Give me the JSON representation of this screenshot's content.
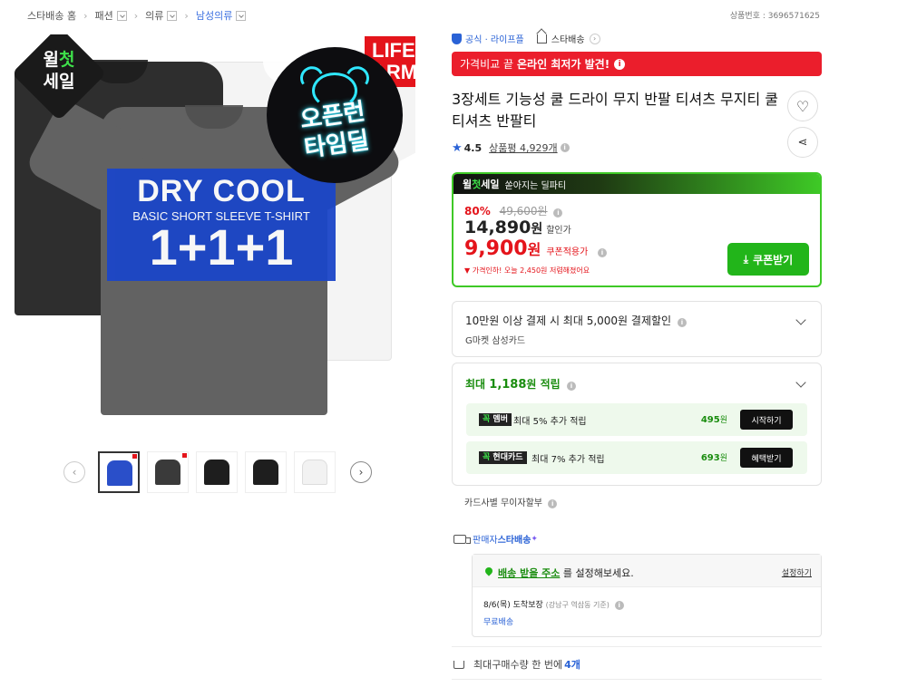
{
  "breadcrumb": {
    "home": "스타배송 홈",
    "level1": "패션",
    "level2": "의류",
    "level3": "남성의류"
  },
  "product_no": "상품번호 : 3696571625",
  "hero": {
    "badge_week_top": "윌",
    "badge_week_accent": "첫",
    "badge_week_bottom": "세일",
    "life_badge": "LIFE ARM",
    "clock_line1": "오픈런",
    "clock_line2": "타임딜",
    "drycool_title": "DRY COOL",
    "drycool_sub": "BASIC SHORT SLEEVE T-SHIRT",
    "drycool_count": "1+1+1"
  },
  "thumbnails": [
    {
      "color": "#2a4fc9",
      "label": "thumb-1"
    },
    {
      "color": "#3a3a3a",
      "label": "thumb-2"
    },
    {
      "color": "#1e1e1e",
      "label": "thumb-3"
    },
    {
      "color": "#1e1e1e",
      "label": "thumb-4"
    },
    {
      "color": "#f2f2f2",
      "label": "thumb-5"
    }
  ],
  "store": {
    "official": "공식 · 라이프플",
    "star_shipping": "스타배송"
  },
  "redbar": {
    "prefix": "가격비교 끝",
    "highlight": "온라인 최저가 발견!"
  },
  "title": "3장세트 기능성 쿨 드라이 무지 반팔 티셔츠 무지티 쿨티셔츠 반팔티",
  "rating": {
    "score": "4.5",
    "reviews": "상품평 4,929개"
  },
  "price": {
    "banner_w": "윌",
    "banner_accent": "첫",
    "banner_rest": "세일",
    "banner_sub": "쏟아지는 딜파티",
    "discount": "80%",
    "original": "49,600원",
    "sale_amount": "14,890",
    "sale_unit": "원",
    "sale_label": "할인가",
    "coupon_amount": "9,900",
    "coupon_unit": "원",
    "coupon_label": "쿠폰적용가",
    "drop_note": "가격인하! 오늘 2,450원 저렴해졌어요",
    "coupon_button": "쿠폰받기"
  },
  "card_discount": {
    "line1": "10만원 이상 결제 시 최대 5,000원 결제할인",
    "line2": "G마켓 삼성카드"
  },
  "points": {
    "prefix": "최대",
    "amount": "1,188",
    "suffix": "원 적립",
    "rows": [
      {
        "tag_a": "꼭",
        "tag_b": "멤버",
        "text": "최대 5% 추가 적립",
        "amount": "495",
        "unit": "원",
        "button": "시작하기"
      },
      {
        "tag_a": "꼭",
        "tag_b": "현대카드",
        "text": "최대 7% 추가 적립",
        "amount": "693",
        "unit": "원",
        "button": "혜택받기"
      }
    ]
  },
  "installment": "카드사별 무이자할부",
  "shipping": {
    "label_a": "판매자",
    "label_b": "스타배송",
    "address_link": "배송 받을 주소",
    "address_rest": " 를 설정해보세요.",
    "set_link": "설정하기",
    "eta": "8/6(목) 도착보장",
    "eta_sub": "(강남구 역삼동 기준)",
    "free": "무료배송"
  },
  "max_qty": {
    "label": "최대구매수량 한 번에",
    "value": "4개"
  }
}
